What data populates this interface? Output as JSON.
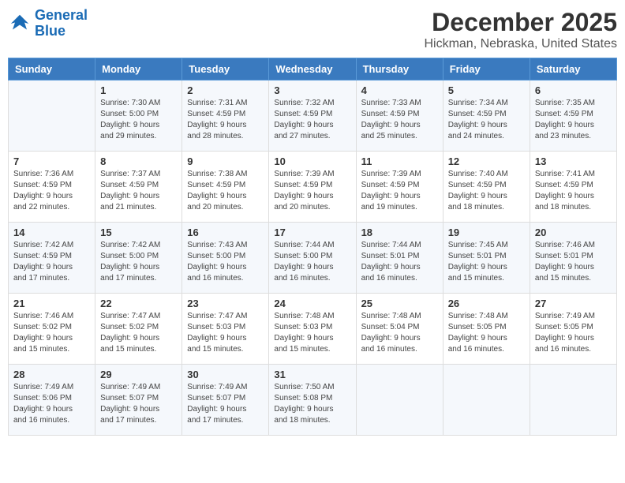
{
  "logo": {
    "line1": "General",
    "line2": "Blue"
  },
  "title": "December 2025",
  "location": "Hickman, Nebraska, United States",
  "days_of_week": [
    "Sunday",
    "Monday",
    "Tuesday",
    "Wednesday",
    "Thursday",
    "Friday",
    "Saturday"
  ],
  "weeks": [
    [
      {
        "day": "",
        "info": ""
      },
      {
        "day": "1",
        "info": "Sunrise: 7:30 AM\nSunset: 5:00 PM\nDaylight: 9 hours\nand 29 minutes."
      },
      {
        "day": "2",
        "info": "Sunrise: 7:31 AM\nSunset: 4:59 PM\nDaylight: 9 hours\nand 28 minutes."
      },
      {
        "day": "3",
        "info": "Sunrise: 7:32 AM\nSunset: 4:59 PM\nDaylight: 9 hours\nand 27 minutes."
      },
      {
        "day": "4",
        "info": "Sunrise: 7:33 AM\nSunset: 4:59 PM\nDaylight: 9 hours\nand 25 minutes."
      },
      {
        "day": "5",
        "info": "Sunrise: 7:34 AM\nSunset: 4:59 PM\nDaylight: 9 hours\nand 24 minutes."
      },
      {
        "day": "6",
        "info": "Sunrise: 7:35 AM\nSunset: 4:59 PM\nDaylight: 9 hours\nand 23 minutes."
      }
    ],
    [
      {
        "day": "7",
        "info": "Sunrise: 7:36 AM\nSunset: 4:59 PM\nDaylight: 9 hours\nand 22 minutes."
      },
      {
        "day": "8",
        "info": "Sunrise: 7:37 AM\nSunset: 4:59 PM\nDaylight: 9 hours\nand 21 minutes."
      },
      {
        "day": "9",
        "info": "Sunrise: 7:38 AM\nSunset: 4:59 PM\nDaylight: 9 hours\nand 20 minutes."
      },
      {
        "day": "10",
        "info": "Sunrise: 7:39 AM\nSunset: 4:59 PM\nDaylight: 9 hours\nand 20 minutes."
      },
      {
        "day": "11",
        "info": "Sunrise: 7:39 AM\nSunset: 4:59 PM\nDaylight: 9 hours\nand 19 minutes."
      },
      {
        "day": "12",
        "info": "Sunrise: 7:40 AM\nSunset: 4:59 PM\nDaylight: 9 hours\nand 18 minutes."
      },
      {
        "day": "13",
        "info": "Sunrise: 7:41 AM\nSunset: 4:59 PM\nDaylight: 9 hours\nand 18 minutes."
      }
    ],
    [
      {
        "day": "14",
        "info": "Sunrise: 7:42 AM\nSunset: 4:59 PM\nDaylight: 9 hours\nand 17 minutes."
      },
      {
        "day": "15",
        "info": "Sunrise: 7:42 AM\nSunset: 5:00 PM\nDaylight: 9 hours\nand 17 minutes."
      },
      {
        "day": "16",
        "info": "Sunrise: 7:43 AM\nSunset: 5:00 PM\nDaylight: 9 hours\nand 16 minutes."
      },
      {
        "day": "17",
        "info": "Sunrise: 7:44 AM\nSunset: 5:00 PM\nDaylight: 9 hours\nand 16 minutes."
      },
      {
        "day": "18",
        "info": "Sunrise: 7:44 AM\nSunset: 5:01 PM\nDaylight: 9 hours\nand 16 minutes."
      },
      {
        "day": "19",
        "info": "Sunrise: 7:45 AM\nSunset: 5:01 PM\nDaylight: 9 hours\nand 15 minutes."
      },
      {
        "day": "20",
        "info": "Sunrise: 7:46 AM\nSunset: 5:01 PM\nDaylight: 9 hours\nand 15 minutes."
      }
    ],
    [
      {
        "day": "21",
        "info": "Sunrise: 7:46 AM\nSunset: 5:02 PM\nDaylight: 9 hours\nand 15 minutes."
      },
      {
        "day": "22",
        "info": "Sunrise: 7:47 AM\nSunset: 5:02 PM\nDaylight: 9 hours\nand 15 minutes."
      },
      {
        "day": "23",
        "info": "Sunrise: 7:47 AM\nSunset: 5:03 PM\nDaylight: 9 hours\nand 15 minutes."
      },
      {
        "day": "24",
        "info": "Sunrise: 7:48 AM\nSunset: 5:03 PM\nDaylight: 9 hours\nand 15 minutes."
      },
      {
        "day": "25",
        "info": "Sunrise: 7:48 AM\nSunset: 5:04 PM\nDaylight: 9 hours\nand 16 minutes."
      },
      {
        "day": "26",
        "info": "Sunrise: 7:48 AM\nSunset: 5:05 PM\nDaylight: 9 hours\nand 16 minutes."
      },
      {
        "day": "27",
        "info": "Sunrise: 7:49 AM\nSunset: 5:05 PM\nDaylight: 9 hours\nand 16 minutes."
      }
    ],
    [
      {
        "day": "28",
        "info": "Sunrise: 7:49 AM\nSunset: 5:06 PM\nDaylight: 9 hours\nand 16 minutes."
      },
      {
        "day": "29",
        "info": "Sunrise: 7:49 AM\nSunset: 5:07 PM\nDaylight: 9 hours\nand 17 minutes."
      },
      {
        "day": "30",
        "info": "Sunrise: 7:49 AM\nSunset: 5:07 PM\nDaylight: 9 hours\nand 17 minutes."
      },
      {
        "day": "31",
        "info": "Sunrise: 7:50 AM\nSunset: 5:08 PM\nDaylight: 9 hours\nand 18 minutes."
      },
      {
        "day": "",
        "info": ""
      },
      {
        "day": "",
        "info": ""
      },
      {
        "day": "",
        "info": ""
      }
    ]
  ]
}
